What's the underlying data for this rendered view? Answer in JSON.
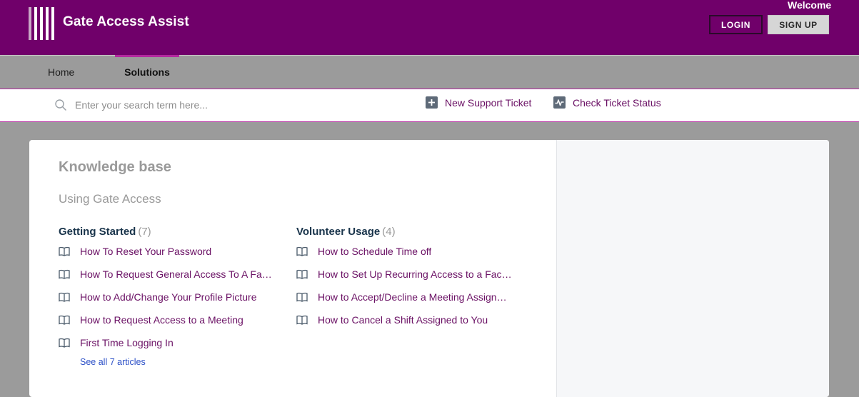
{
  "header": {
    "brand": "Gate Access Assist",
    "welcome": "Welcome",
    "login_label": "LOGIN",
    "signup_label": "SIGN UP"
  },
  "nav": {
    "items": [
      {
        "label": "Home",
        "active": false
      },
      {
        "label": "Solutions",
        "active": true
      }
    ]
  },
  "search": {
    "placeholder": "Enter your search term here...",
    "value": ""
  },
  "actions": {
    "new_ticket": "New Support Ticket",
    "check_status": "Check Ticket Status"
  },
  "kb": {
    "title": "Knowledge base",
    "subtitle": "Using Gate Access",
    "categories": [
      {
        "name": "Getting Started",
        "count": "(7)",
        "articles": [
          "How To Reset Your Password",
          "How To Request General Access To A Faci…",
          "How to Add/Change Your Profile Picture",
          "How to Request Access to a Meeting",
          "First Time Logging In"
        ],
        "see_all": "See all 7 articles"
      },
      {
        "name": "Volunteer Usage",
        "count": "(4)",
        "articles": [
          "How to Schedule Time off",
          "How to Set Up Recurring Access to a Facil…",
          "How to Accept/Decline a Meeting Assign…",
          "How to Cancel a Shift Assigned to You"
        ]
      }
    ]
  },
  "colors": {
    "brand": "#70006a",
    "accent": "#b3289f",
    "link": "#6a1064",
    "see_all": "#2b4fc7"
  }
}
